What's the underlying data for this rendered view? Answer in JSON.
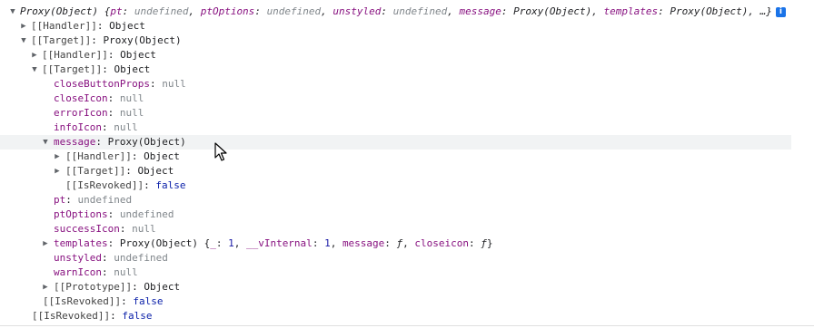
{
  "console": {
    "summary": {
      "prefix": "Proxy(Object) {",
      "items": [
        {
          "key": "pt",
          "value": "undefined"
        },
        {
          "key": "ptOptions",
          "value": "undefined"
        },
        {
          "key": "unstyled",
          "value": "undefined"
        },
        {
          "key": "message",
          "value": "Proxy(Object)"
        },
        {
          "key": "templates",
          "value": "Proxy(Object)"
        }
      ],
      "suffix": "…}",
      "info_badge": "i"
    },
    "rows": {
      "handler1": {
        "key": "[[Handler]]",
        "value": "Object"
      },
      "target1": {
        "key": "[[Target]]",
        "value": "Proxy(Object)"
      },
      "handler2": {
        "key": "[[Handler]]",
        "value": "Object"
      },
      "target2": {
        "key": "[[Target]]",
        "value": "Object"
      },
      "closeButtonProps": {
        "key": "closeButtonProps",
        "value": "null"
      },
      "closeIcon": {
        "key": "closeIcon",
        "value": "null"
      },
      "errorIcon": {
        "key": "errorIcon",
        "value": "null"
      },
      "infoIcon": {
        "key": "infoIcon",
        "value": "null"
      },
      "message": {
        "key": "message",
        "value": "Proxy(Object)"
      },
      "msgHandler": {
        "key": "[[Handler]]",
        "value": "Object"
      },
      "msgTarget": {
        "key": "[[Target]]",
        "value": "Object"
      },
      "msgRevoked": {
        "key": "[[IsRevoked]]",
        "value": "false"
      },
      "pt": {
        "key": "pt",
        "value": "undefined"
      },
      "ptOptions": {
        "key": "ptOptions",
        "value": "undefined"
      },
      "successIcon": {
        "key": "successIcon",
        "value": "null"
      },
      "templates": {
        "key": "templates",
        "value": "Proxy(Object)",
        "preview": {
          "open": "{",
          "items": [
            {
              "key": "_",
              "value": "1"
            },
            {
              "key": "__vInternal",
              "value": "1"
            },
            {
              "key": "message",
              "value": "ƒ"
            },
            {
              "key": "closeicon",
              "value": "ƒ"
            }
          ],
          "close": "}"
        }
      },
      "unstyled": {
        "key": "unstyled",
        "value": "undefined"
      },
      "warnIcon": {
        "key": "warnIcon",
        "value": "null"
      },
      "prototype": {
        "key": "[[Prototype]]",
        "value": "Object"
      },
      "revoked2": {
        "key": "[[IsRevoked]]",
        "value": "false"
      },
      "revoked1": {
        "key": "[[IsRevoked]]",
        "value": "false"
      }
    },
    "separators": {
      "colon": ": ",
      "comma": ", "
    },
    "icons": {
      "expanded": "▼",
      "collapsed": "▶"
    }
  }
}
